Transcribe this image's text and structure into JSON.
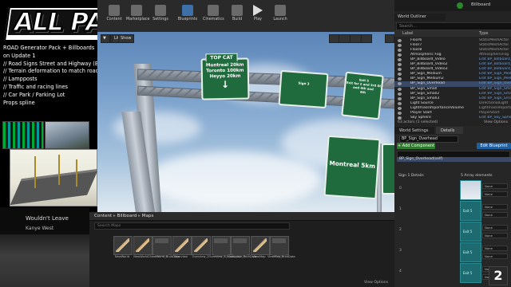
{
  "promo": {
    "logo": "ALL PACS!",
    "lines": [
      "ROAD Generator Pack + Billboards",
      "on Update 1",
      "// Road Signs Street and Highway (Both Packs)",
      "// Terrain deformation to match road",
      "// Lampposts",
      "// Traffic and racing lines",
      "// Car Park / Parking Lot",
      "Props spline"
    ],
    "video_title": "Wouldn't Leave",
    "video_artist": "Kanye West"
  },
  "window": {
    "title": "Billboard"
  },
  "toolbar": {
    "buttons": [
      "Content",
      "Marketplace",
      "Settings",
      "Blueprints",
      "Cinematics",
      "Build",
      "Play",
      "Launch"
    ]
  },
  "viewport": {
    "buttons": [
      "Lit",
      "Show"
    ],
    "signs": {
      "top_cat_tab": "TOP CAT",
      "main_lines": [
        "Montreal 20km",
        "Toronto 100km",
        "Heyyo 20km"
      ],
      "right_lines": [
        "Sign 3",
        "Hit 5th and 6th and 8th"
      ],
      "right_lines2": [
        "Exit 5",
        "Exit for 2 and 3rd St",
        "and 4th and",
        "4th"
      ],
      "lower_sign": "Montreal 5km"
    }
  },
  "outliner": {
    "tab": "World Outliner",
    "search_placeholder": "Search...",
    "col_label": "Label",
    "col_type": "Type",
    "rows": [
      {
        "name": "Floor6",
        "type": "StaticMeshActor"
      },
      {
        "name": "Floor7",
        "type": "StaticMeshActor"
      },
      {
        "name": "Floor8",
        "type": "StaticMeshActor"
      },
      {
        "name": "Atmospheric Fog",
        "type": "AtmosphericFog"
      },
      {
        "name": "BP_Billboard_Video",
        "type": "Edit BP_Billboard_Video"
      },
      {
        "name": "BP_Billboard_Video2",
        "type": "Edit BP_Billboard_Video"
      },
      {
        "name": "BP_Billboard_Video3",
        "type": "Edit BP_Billboard_Video"
      },
      {
        "name": "BP_Sign_Medium",
        "type": "Edit BP_Sign_Medium"
      },
      {
        "name": "BP_Sign_Medium2",
        "type": "Edit BP_Sign_Medium"
      },
      {
        "name": "BP_Sign_Overhead",
        "type": "Edit BP_Sign_Overhead"
      },
      {
        "name": "BP_Sign_Small",
        "type": "Edit BP_Sign_Small"
      },
      {
        "name": "BP_Sign_Small2",
        "type": "Edit BP_Sign_Small"
      },
      {
        "name": "BP_Sign_Small3",
        "type": "Edit BP_Sign_Small"
      },
      {
        "name": "Light Source",
        "type": "DirectionalLight"
      },
      {
        "name": "LightmassImportanceVolume",
        "type": "LightmassImportanceVolume"
      },
      {
        "name": "Player Start",
        "type": "PlayerStart"
      },
      {
        "name": "Sky Sphere",
        "type": "Edit BP_Sky_Sphere"
      }
    ],
    "footer": "63 actors (1 selected)",
    "view_options": "View Options"
  },
  "details": {
    "tab": "World Settings",
    "tab2": "Details",
    "name": "BP_Sign_Overhead",
    "add_component": "+ Add Component",
    "edit_blueprint": "Edit Blueprint",
    "component_row": "BP_Sign_Overhead(self)",
    "section": "Sign 1 Details",
    "section_right": "5 Array elements",
    "indices": [
      "0",
      "1",
      "2",
      "3",
      "4"
    ],
    "slot_label": "Exit 5",
    "dropdown": "None",
    "avatar": "2"
  },
  "content_browser": {
    "path": [
      "Content",
      "Billboard",
      "Maps"
    ],
    "filter_placeholder": "Search Maps",
    "assets": [
      {
        "label": "NewWorld",
        "kind": "map"
      },
      {
        "label": "NewWorld2",
        "kind": "map"
      },
      {
        "label": "NewWorld_BuiltData",
        "kind": "data"
      },
      {
        "label": "Overview",
        "kind": "map"
      },
      {
        "label": "Overview_2",
        "kind": "map"
      },
      {
        "label": "Overview_3_BuiltData",
        "kind": "data"
      },
      {
        "label": "Overview_BuiltData",
        "kind": "data"
      },
      {
        "label": "ViewMap",
        "kind": "map"
      },
      {
        "label": "ViewMap_BuiltData",
        "kind": "data"
      }
    ],
    "view_options": "View Options"
  },
  "colors": {
    "sign_green": "#1f6b3e",
    "add_component": "#2f7a2f",
    "edit_blueprint": "#1f5fa0",
    "selection": "#3a4a66",
    "slot_teal": "#1d6b70"
  }
}
